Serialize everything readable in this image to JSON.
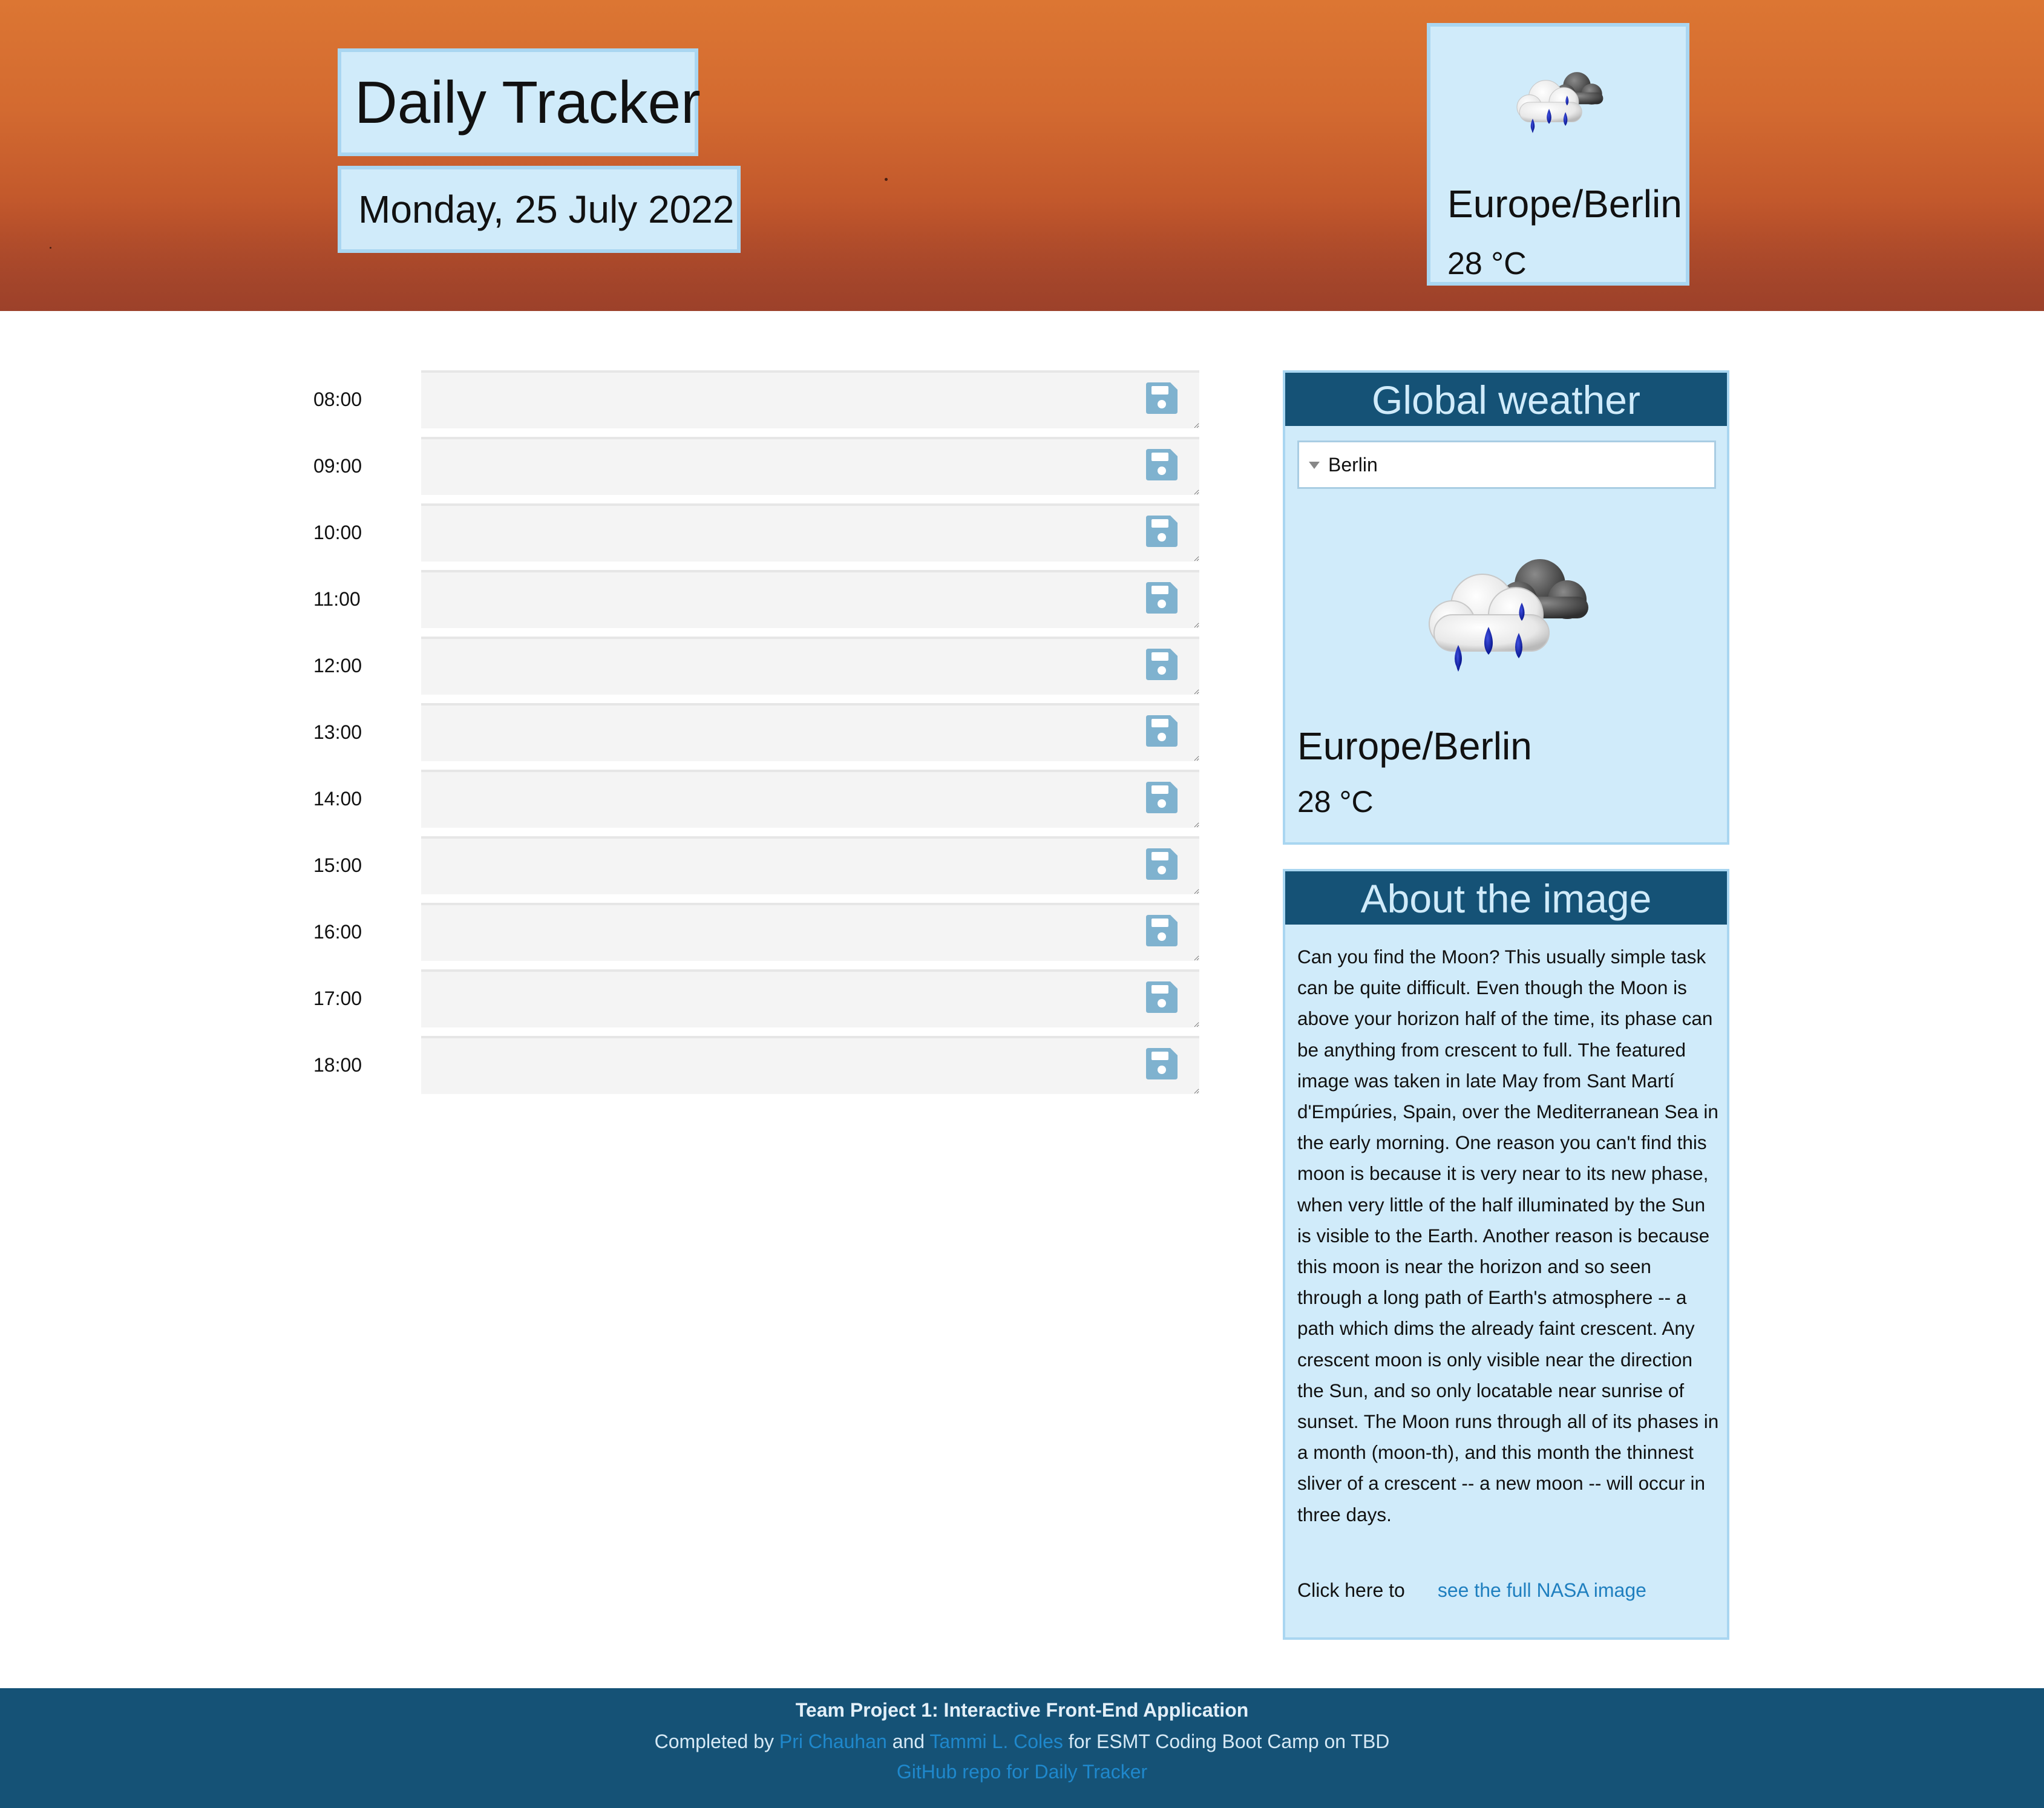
{
  "header": {
    "title": "Daily Tracker",
    "date": "Monday, 25 July 2022",
    "weather": {
      "icon": "rain-cloud-icon",
      "city": "Europe/Berlin",
      "temperature": "28 °C"
    }
  },
  "planner": {
    "hours": [
      {
        "time": "08:00",
        "entry": ""
      },
      {
        "time": "09:00",
        "entry": ""
      },
      {
        "time": "10:00",
        "entry": ""
      },
      {
        "time": "11:00",
        "entry": ""
      },
      {
        "time": "12:00",
        "entry": ""
      },
      {
        "time": "13:00",
        "entry": ""
      },
      {
        "time": "14:00",
        "entry": ""
      },
      {
        "time": "15:00",
        "entry": ""
      },
      {
        "time": "16:00",
        "entry": ""
      },
      {
        "time": "17:00",
        "entry": ""
      },
      {
        "time": "18:00",
        "entry": ""
      }
    ],
    "save_icon": "floppy-disk-icon"
  },
  "global_weather": {
    "heading": "Global weather",
    "selected_city": "Berlin",
    "icon": "rain-cloud-icon",
    "city": "Europe/Berlin",
    "temperature": "28 °C"
  },
  "about_image": {
    "heading": "About the image",
    "text": "Can you find the Moon? This usually simple task can be quite difficult. Even though the Moon is above your horizon half of the time, its phase can be anything from crescent to full. The featured image was taken in late May from Sant Martí d'Empúries, Spain, over the Mediterranean Sea in the early morning. One reason you can't find this moon is because it is very near to its new phase, when very little of the half illuminated by the Sun is visible to the Earth. Another reason is because this moon is near the horizon and so seen through a long path of Earth's atmosphere -- a path which dims the already faint crescent. Any crescent moon is only visible near the direction the Sun, and so only locatable near sunrise of sunset. The Moon runs through all of its phases in a month (moon-th), and this month the thinnest sliver of a crescent -- a new moon -- will occur in three days.",
    "link_prefix": "Click here to",
    "link_label": "see the full NASA image"
  },
  "footer": {
    "project": "Team Project 1: Interactive Front-End Application",
    "completed_by": "Completed by",
    "author1": "Pri Chauhan",
    "and": "and",
    "author2": "Tammi L. Coles",
    "suffix": "for ESMT Coding Boot Camp on TBD",
    "repo_link": "GitHub repo for Daily Tracker"
  },
  "colors": {
    "accent_dark": "#155276",
    "panel_light": "#d0ebfa",
    "link": "#1f7fbf",
    "save_icon": "#7fb2cf"
  }
}
